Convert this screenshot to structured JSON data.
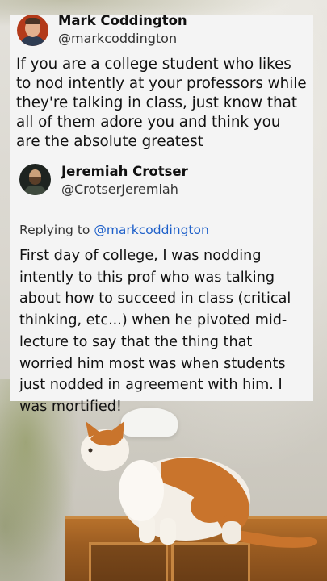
{
  "tweet": {
    "author_name": "Mark Coddington",
    "author_handle": "@markcoddington",
    "avatar_icon": "profile-photo-icon",
    "text": "If you are a college student who likes to nod intently at your professors while they're talking in class, just know that all of them adore you and think you are the absolute greatest"
  },
  "reply": {
    "author_name": "Jeremiah Crotser",
    "author_handle": "@CrotserJeremiah",
    "avatar_icon": "profile-photo-icon",
    "replying_prefix": "Replying to",
    "replying_to": "@markcoddington",
    "text": "First day of college, I was nodding intently to this prof who was talking about how to succeed in class (critical thinking, etc...) when he pivoted mid-lecture to say that the thing that worried him most was when students just nodded in agreement with him. I was mortified!"
  },
  "colors": {
    "card_background": "#f4f4f4",
    "mention_link": "#1d5fc9",
    "text": "#111111"
  },
  "background_photo": {
    "subject": "orange-and-white cat sitting on a wooden cabinet"
  }
}
